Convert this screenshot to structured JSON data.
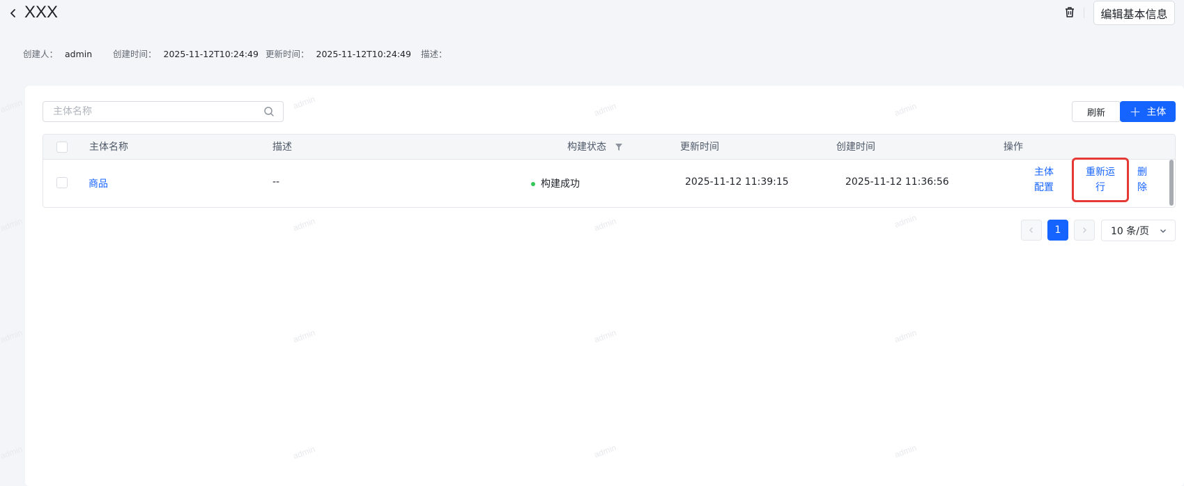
{
  "header": {
    "title": "XXX",
    "edit_label": "编辑基本信息"
  },
  "meta": {
    "creator_label": "创建人：",
    "creator_value": "admin",
    "created_label": "创建时间：",
    "created_value": "2025-11-12T10:24:49",
    "updated_label": "更新时间：",
    "updated_value": "2025-11-12T10:24:49",
    "desc_label": "描述：",
    "desc_value": ""
  },
  "toolbar": {
    "search_placeholder": "主体名称",
    "refresh_label": "刷新",
    "add_label": "主体"
  },
  "table": {
    "columns": [
      "主体名称",
      "描述",
      "构建状态",
      "更新时间",
      "创建时间",
      "操作"
    ],
    "rows": [
      {
        "name": "商品",
        "description": "--",
        "status": "构建成功",
        "updated": "2025-11-12 11:39:15",
        "created": "2025-11-12 11:36:56",
        "actions": [
          "主体配置",
          "重新运行",
          "删除"
        ]
      }
    ]
  },
  "pagination": {
    "current_page": "1",
    "page_size": "10 条/页"
  },
  "watermark": "admin",
  "colors": {
    "primary": "#1664ff",
    "success": "#34c759",
    "highlight": "#e53935"
  }
}
